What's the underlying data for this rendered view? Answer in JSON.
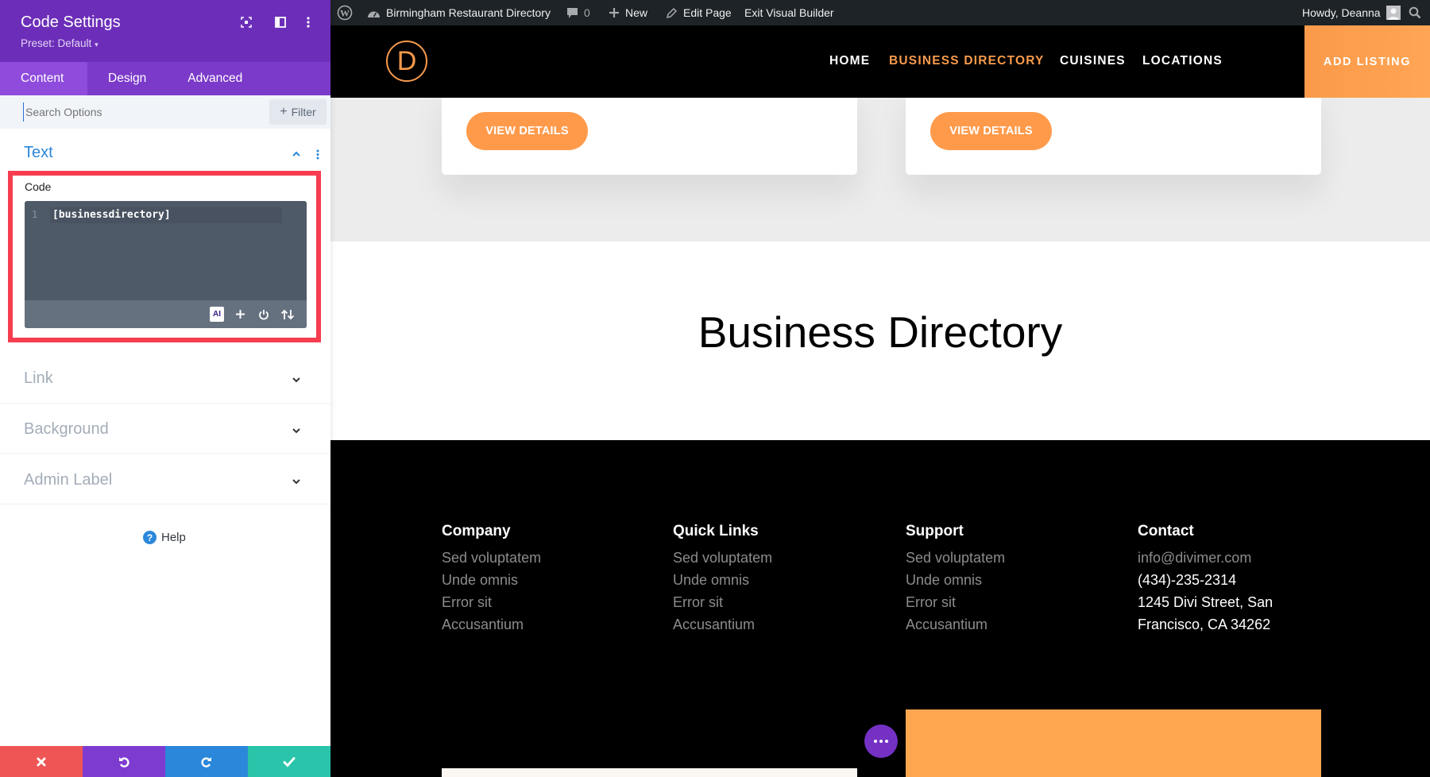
{
  "sidebar": {
    "title": "Code Settings",
    "preset": "Preset: Default",
    "tabs": [
      {
        "label": "Content",
        "active": true
      },
      {
        "label": "Design",
        "active": false
      },
      {
        "label": "Advanced",
        "active": false
      }
    ],
    "search_placeholder": "Search Options",
    "filter_label": "Filter",
    "sections": {
      "text": "Text",
      "link": "Link",
      "background": "Background",
      "admin_label": "Admin Label"
    },
    "code_field": {
      "label": "Code",
      "line_number": "1",
      "value": "[businessdirectory]",
      "ai_label": "AI"
    },
    "help_label": "Help",
    "footer_colors": {
      "discard": "#ef5555",
      "undo": "#7e3bd0",
      "redo": "#2b87da",
      "save": "#29c4a9"
    }
  },
  "adminbar": {
    "site_name": "Birmingham Restaurant Directory",
    "comments_count": "0",
    "new_label": "New",
    "edit_page_label": "Edit Page",
    "exit_label": "Exit Visual Builder",
    "howdy": "Howdy, Deanna"
  },
  "site": {
    "logo_letter": "D",
    "nav": [
      {
        "label": "HOME",
        "active": false
      },
      {
        "label": "BUSINESS DIRECTORY",
        "active": true
      },
      {
        "label": "CUISINES",
        "active": false
      },
      {
        "label": "LOCATIONS",
        "active": false
      }
    ],
    "cta": "ADD LISTING",
    "accent": "#f89a4b",
    "cards": [
      {
        "button": "VIEW DETAILS"
      },
      {
        "button": "VIEW DETAILS"
      }
    ],
    "heading": "Business Directory",
    "footer": {
      "columns": [
        {
          "title": "Company",
          "items": [
            "Sed voluptatem",
            "Unde omnis",
            "Error sit",
            "Accusantium"
          ]
        },
        {
          "title": "Quick Links",
          "items": [
            "Sed voluptatem",
            "Unde omnis",
            "Error sit",
            "Accusantium"
          ]
        },
        {
          "title": "Support",
          "items": [
            "Sed voluptatem",
            "Unde omnis",
            "Error sit",
            "Accusantium"
          ]
        },
        {
          "title": "Contact",
          "items": [
            "info@divimer.com",
            "(434)-235-2314",
            "1245 Divi Street, San",
            "Francisco, CA 34262"
          ]
        }
      ]
    }
  }
}
